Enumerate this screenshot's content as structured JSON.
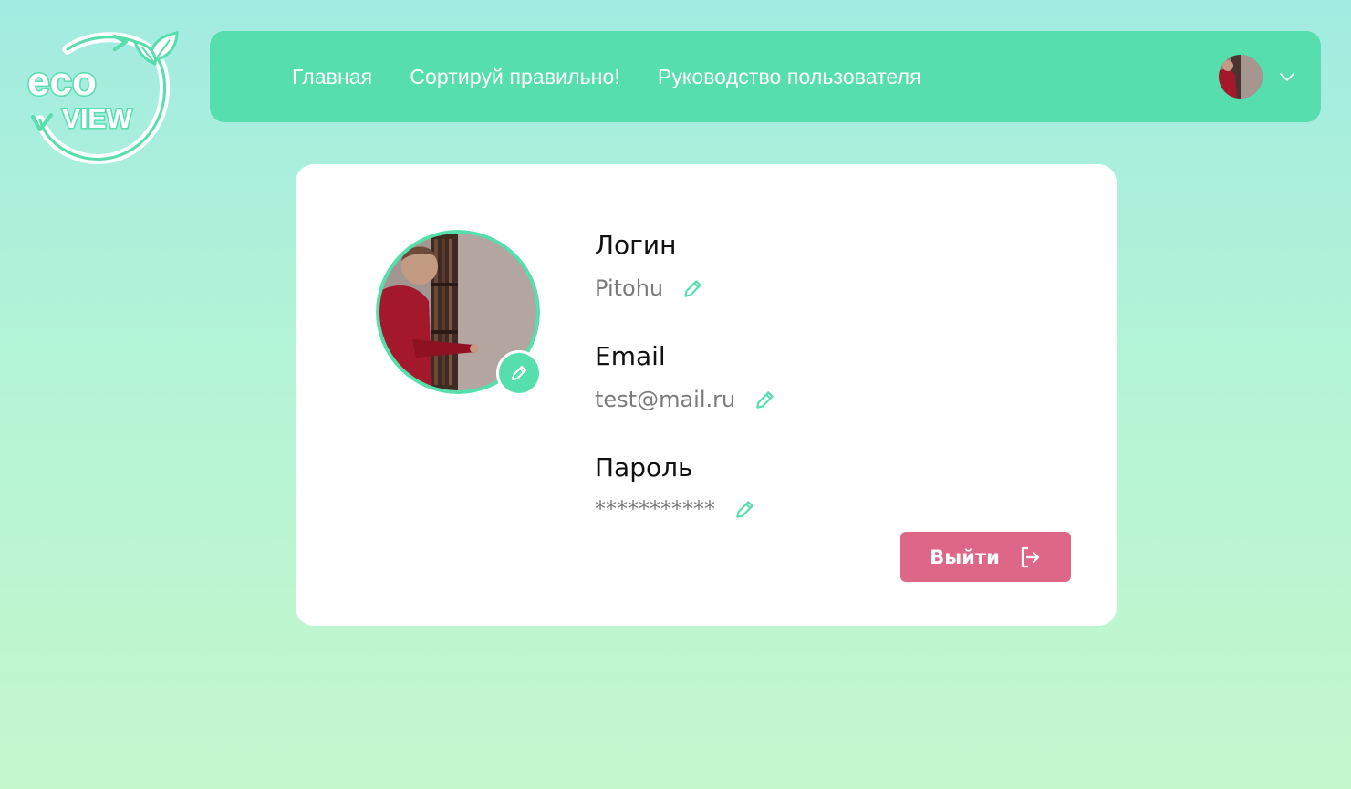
{
  "logo": {
    "line1": "eco",
    "line2": "VIEW"
  },
  "header": {
    "nav": [
      {
        "label": "Главная"
      },
      {
        "label": "Сортируй правильно!"
      },
      {
        "label": "Руководство пользователя"
      }
    ],
    "user_menu": {
      "avatar_icon": "user-avatar-photo",
      "dropdown_icon": "chevron-down-icon"
    }
  },
  "profile": {
    "login": {
      "label": "Логин",
      "value": "Pitohu"
    },
    "email": {
      "label": "Email",
      "value": "test@mail.ru"
    },
    "password": {
      "label": "Пароль",
      "value": "***********"
    },
    "logout": {
      "label": "Выйти",
      "icon": "logout-icon"
    },
    "edit_icon": "pencil-icon"
  },
  "colors": {
    "accent": "#56dead",
    "logout": "#de6687",
    "card": "#ffffff",
    "text_label": "#111111",
    "text_value": "#7a7a7a"
  }
}
